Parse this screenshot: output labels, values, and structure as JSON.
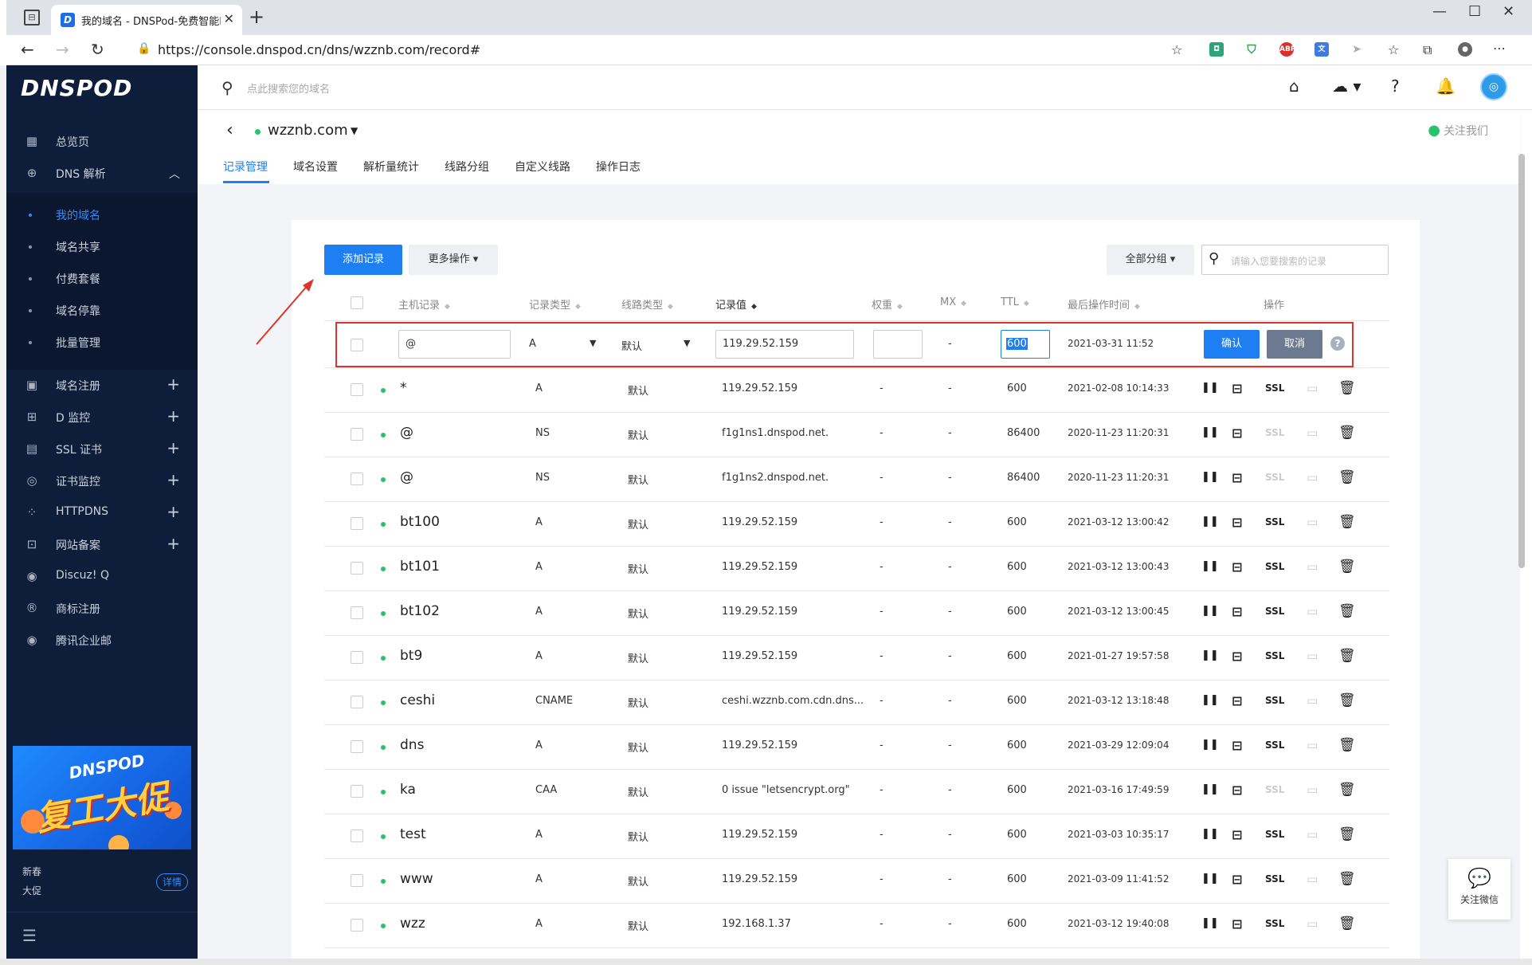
{
  "browser": {
    "tab_title": "我的域名 - DNSPod-免费智能DN",
    "tab_close": "✕",
    "new_tab": "+",
    "url": "https://console.dnspod.cn/dns/wzznb.com/record#",
    "win_min": "—",
    "win_max": "☐",
    "win_close": "✕"
  },
  "sidebar": {
    "logo": "DNSPOD",
    "items": [
      {
        "label": "总览页",
        "icon": "dashboard-icon"
      },
      {
        "label": "DNS 解析",
        "icon": "globe-icon",
        "expanded": true
      },
      {
        "label": "我的域名",
        "active": true
      },
      {
        "label": "域名共享"
      },
      {
        "label": "付费套餐"
      },
      {
        "label": "域名停靠"
      },
      {
        "label": "批量管理"
      },
      {
        "label": "域名注册",
        "icon": "register-icon"
      },
      {
        "label": "D 监控",
        "icon": "monitor-icon"
      },
      {
        "label": "SSL 证书",
        "icon": "ssl-cert-icon"
      },
      {
        "label": "证书监控",
        "icon": "cert-monitor-icon"
      },
      {
        "label": "HTTPDNS",
        "icon": "httpdns-icon"
      },
      {
        "label": "网站备案",
        "icon": "filing-icon"
      },
      {
        "label": "Discuz! Q",
        "icon": "discuz-icon"
      },
      {
        "label": "商标注册",
        "icon": "trademark-icon"
      },
      {
        "label": "腾讯企业邮",
        "icon": "mail-icon"
      }
    ],
    "promo_brand": "DNSPOD",
    "promo_title": "复工大促",
    "promo_line1": "新春",
    "promo_line2": "大促",
    "detail": "详情"
  },
  "topbar": {
    "search_placeholder": "点此搜索您的域名"
  },
  "domain": {
    "name": "wzznb.com",
    "follow": "关注我们",
    "tabs": [
      "记录管理",
      "域名设置",
      "解析量统计",
      "线路分组",
      "自定义线路",
      "操作日志"
    ]
  },
  "toolbar": {
    "add": "添加记录",
    "more": "更多操作",
    "group": "全部分组",
    "search_placeholder": "请输入您要搜索的记录"
  },
  "table": {
    "headers": [
      "主机记录",
      "记录类型",
      "线路类型",
      "记录值",
      "权重",
      "MX",
      "TTL",
      "最后操作时间",
      "操作"
    ],
    "edit_row": {
      "host": "@",
      "type": "A",
      "line": "默认",
      "value": "119.29.52.159",
      "weight": "",
      "mx": "-",
      "ttl": "600",
      "time": "2021-03-31 11:52",
      "confirm": "确认",
      "cancel": "取消"
    },
    "rows": [
      {
        "host": "*",
        "type": "A",
        "line": "默认",
        "value": "119.29.52.159",
        "weight": "-",
        "mx": "-",
        "ttl": "600",
        "time": "2021-02-08 10:14:33",
        "ssl": true
      },
      {
        "host": "@",
        "type": "NS",
        "line": "默认",
        "value": "f1g1ns1.dnspod.net.",
        "weight": "-",
        "mx": "-",
        "ttl": "86400",
        "time": "2020-11-23 11:20:31",
        "ssl": false
      },
      {
        "host": "@",
        "type": "NS",
        "line": "默认",
        "value": "f1g1ns2.dnspod.net.",
        "weight": "-",
        "mx": "-",
        "ttl": "86400",
        "time": "2020-11-23 11:20:31",
        "ssl": false
      },
      {
        "host": "bt100",
        "type": "A",
        "line": "默认",
        "value": "119.29.52.159",
        "weight": "-",
        "mx": "-",
        "ttl": "600",
        "time": "2021-03-12 13:00:42",
        "ssl": true
      },
      {
        "host": "bt101",
        "type": "A",
        "line": "默认",
        "value": "119.29.52.159",
        "weight": "-",
        "mx": "-",
        "ttl": "600",
        "time": "2021-03-12 13:00:43",
        "ssl": true
      },
      {
        "host": "bt102",
        "type": "A",
        "line": "默认",
        "value": "119.29.52.159",
        "weight": "-",
        "mx": "-",
        "ttl": "600",
        "time": "2021-03-12 13:00:45",
        "ssl": true
      },
      {
        "host": "bt9",
        "type": "A",
        "line": "默认",
        "value": "119.29.52.159",
        "weight": "-",
        "mx": "-",
        "ttl": "600",
        "time": "2021-01-27 19:57:58",
        "ssl": true
      },
      {
        "host": "ceshi",
        "type": "CNAME",
        "line": "默认",
        "value": "ceshi.wzznb.com.cdn.dns...",
        "weight": "-",
        "mx": "-",
        "ttl": "600",
        "time": "2021-03-12 13:18:48",
        "ssl": true
      },
      {
        "host": "dns",
        "type": "A",
        "line": "默认",
        "value": "119.29.52.159",
        "weight": "-",
        "mx": "-",
        "ttl": "600",
        "time": "2021-03-29 12:09:04",
        "ssl": true
      },
      {
        "host": "ka",
        "type": "CAA",
        "line": "默认",
        "value": "0 issue \"letsencrypt.org\"",
        "weight": "-",
        "mx": "-",
        "ttl": "600",
        "time": "2021-03-16 17:49:59",
        "ssl": false
      },
      {
        "host": "test",
        "type": "A",
        "line": "默认",
        "value": "119.29.52.159",
        "weight": "-",
        "mx": "-",
        "ttl": "600",
        "time": "2021-03-03 10:35:17",
        "ssl": true
      },
      {
        "host": "www",
        "type": "A",
        "line": "默认",
        "value": "119.29.52.159",
        "weight": "-",
        "mx": "-",
        "ttl": "600",
        "time": "2021-03-09 11:41:52",
        "ssl": true
      },
      {
        "host": "wzz",
        "type": "A",
        "line": "默认",
        "value": "192.168.1.37",
        "weight": "-",
        "mx": "-",
        "ttl": "600",
        "time": "2021-03-12 19:40:08",
        "ssl": true
      }
    ],
    "ssl_label": "SSL"
  },
  "float": {
    "follow_wechat": "关注微信"
  }
}
